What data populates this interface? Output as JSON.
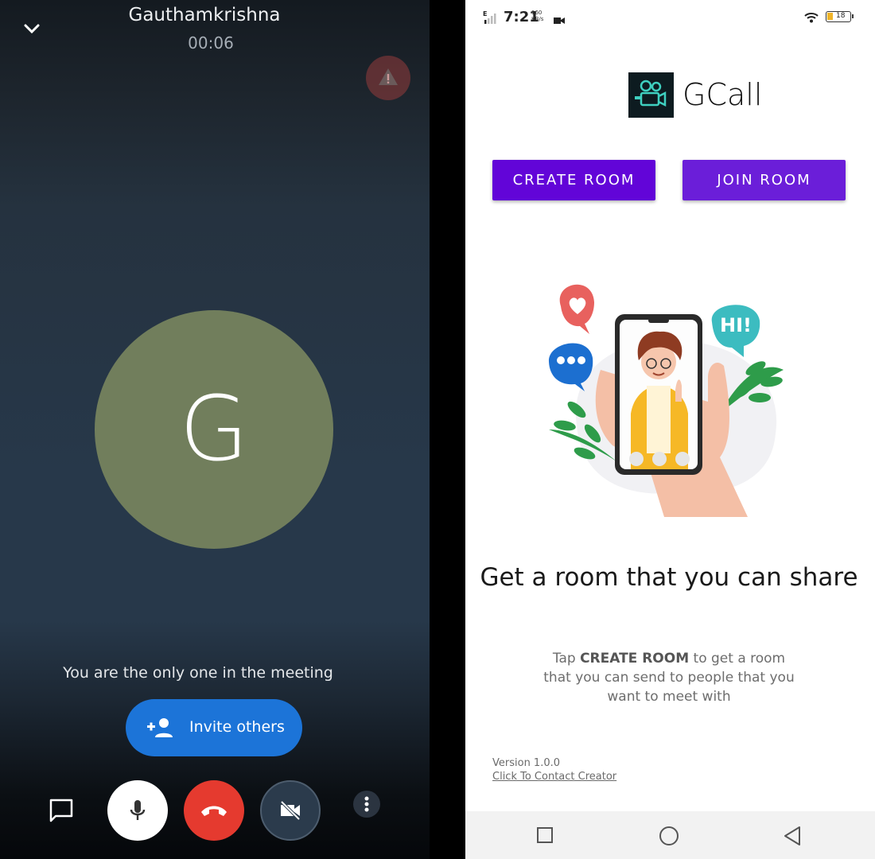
{
  "meeting": {
    "caller_name": "Gauthamkrishna",
    "timer": "00:06",
    "avatar_initial": "G",
    "status_message": "You are the only one in the meeting",
    "invite_label": "Invite others",
    "colors": {
      "avatar_bg": "#717e5c",
      "invite_bg": "#1c74d8",
      "end_call": "#e53a2f"
    }
  },
  "app": {
    "status_bar": {
      "network": "E",
      "time": "7:21",
      "speed_value": "160",
      "speed_unit": "KB/s",
      "battery": "18"
    },
    "title": "GCall",
    "create_room_label": "CREATE ROOM",
    "join_room_label": "JOIN ROOM",
    "headline": "Get a room that you can share",
    "subtext_prefix": "Tap ",
    "subtext_emphasis": "CREATE ROOM",
    "subtext_suffix": " to get a room that you can send to people that you want to meet with",
    "version": "Version 1.0.0",
    "contact_link": "Click To Contact Creator",
    "illustration_speech": "HI!",
    "colors": {
      "primary": "#6205d8",
      "accent": "#6b1ed9"
    }
  }
}
